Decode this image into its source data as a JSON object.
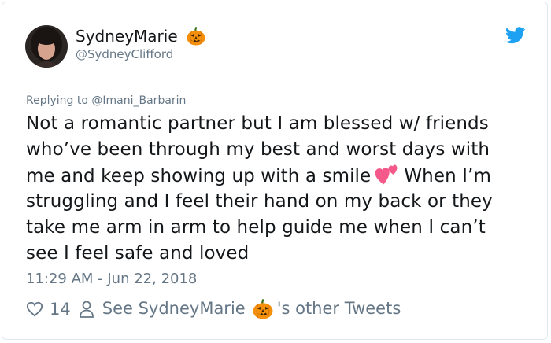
{
  "user": {
    "display_name": "SydneyMarie",
    "name_emoji": "jack-o-lantern",
    "handle": "@SydneyClifford"
  },
  "reply": {
    "prefix": "Replying to",
    "mention": "@Imani_Barbarin"
  },
  "tweet": {
    "lines": [
      "Not a romantic partner but I am blessed w/ friends",
      "who’ve been through my best and worst days with",
      "me and keep showing up with a smile",
      "When I’m",
      "struggling and I feel their hand on my back or they",
      "take me arm in arm to help guide me when I can’t",
      "see I feel safe and loved"
    ],
    "inline_emoji": "two-hearts"
  },
  "timestamp": "11:29 AM - Jun 22, 2018",
  "actions": {
    "like_count": "14",
    "see_prefix": "See SydneyMarie",
    "see_suffix": "'s other Tweets"
  },
  "colors": {
    "text": "#14171a",
    "secondary": "#657786",
    "twitter_blue": "#1da1f2",
    "border": "#e1e8ed",
    "pumpkin": "#f4900c",
    "heart_pink": "#f4598a"
  }
}
